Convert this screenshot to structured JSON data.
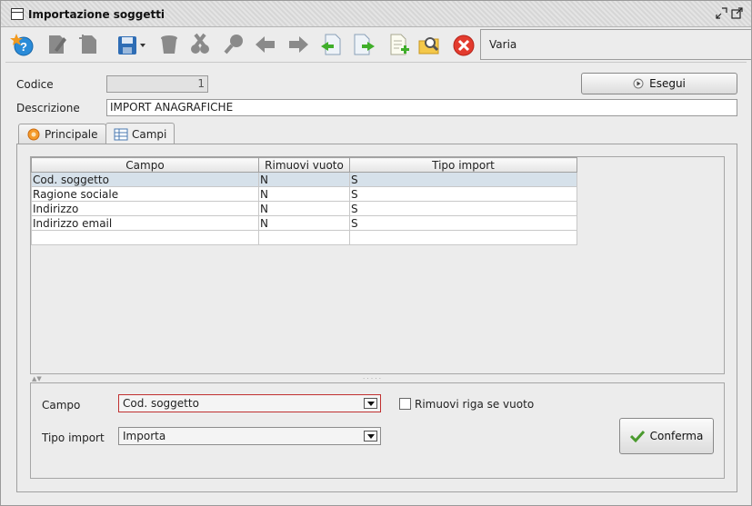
{
  "window": {
    "title": "Importazione soggetti"
  },
  "toolbar": {
    "icons": [
      "help-icon",
      "edit-icon",
      "new-icon",
      "save-icon",
      "delete-icon",
      "cut-icon",
      "search-icon",
      "prev-icon",
      "next-icon",
      "import-icon",
      "export-icon",
      "add-doc-icon",
      "find-icon",
      "close-icon"
    ],
    "varia_label": "Varia"
  },
  "form": {
    "codice_label": "Codice",
    "codice_value": "1",
    "descrizione_label": "Descrizione",
    "descrizione_value": "IMPORT ANAGRAFICHE",
    "esegui_label": "Esegui"
  },
  "tabs": [
    {
      "label": "Principale",
      "active": false
    },
    {
      "label": "Campi",
      "active": true
    }
  ],
  "table": {
    "columns": [
      "Campo",
      "Rimuovi vuoto",
      "Tipo import"
    ],
    "rows": [
      [
        "Cod. soggetto",
        "N",
        "S"
      ],
      [
        "Ragione sociale",
        "N",
        "S"
      ],
      [
        "Indirizzo",
        "N",
        "S"
      ],
      [
        "Indirizzo email",
        "N",
        "S"
      ],
      [
        "",
        "",
        ""
      ]
    ]
  },
  "detail": {
    "campo_label": "Campo",
    "campo_value": "Cod. soggetto",
    "tipo_label": "Tipo import",
    "tipo_value": "Importa",
    "rimuovi_label": "Rimuovi riga se vuoto",
    "rimuovi_checked": false,
    "conferma_label": "Conferma"
  },
  "colors": {
    "selected_row": "#d6e1ea",
    "error_border": "#c03030"
  }
}
